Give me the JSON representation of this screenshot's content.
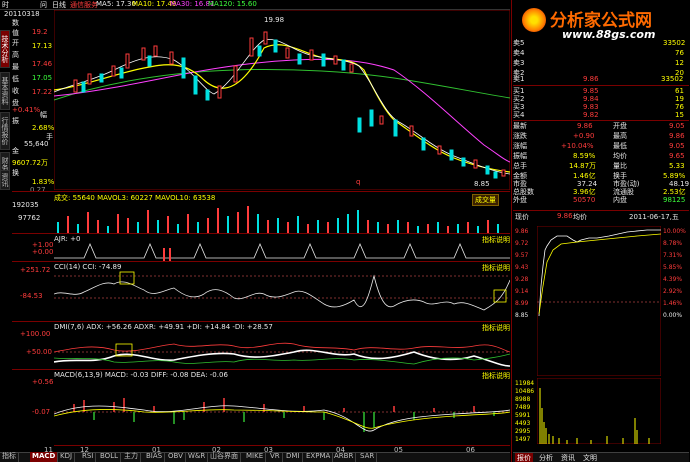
{
  "header": {
    "menu": [
      "时",
      "问",
      "日线",
      "通信服务"
    ],
    "date": "20110318",
    "ma5": "MA5: 17.30",
    "ma10": "MA10: 17.49",
    "ma30": "MA30: 16.81",
    "ma120": "MA120: 15.60",
    "high_mark": "19.98",
    "low_mark": "8.85",
    "mark_q": "q"
  },
  "logo": {
    "text": "分析家公式网",
    "url": "www.88gs.com"
  },
  "left_panel": {
    "items": [
      {
        "label": "数",
        "value": ""
      },
      {
        "label": "值",
        "value": "19.2"
      },
      {
        "label": "开",
        "value": "17.13"
      },
      {
        "label": "高",
        "value": ""
      },
      {
        "label": "最",
        "value": "17.46"
      },
      {
        "label": "低",
        "value": "17.05"
      },
      {
        "label": "收",
        "value": "17.22"
      },
      {
        "label": "盘",
        "value": ""
      },
      {
        "label": "幅",
        "value": "+0.41%"
      },
      {
        "label": "振",
        "value": "2.68%"
      },
      {
        "label": "手",
        "value": "55,640"
      },
      {
        "label": "金",
        "value": "9607.72万"
      },
      {
        "label": "换",
        "value": "1.83%"
      }
    ],
    "y_labels": [
      "0.00",
      "0.27"
    ]
  },
  "side_tabs": [
    "技术分析",
    "基本资料",
    "行情报价",
    "财务图示",
    "资讯"
  ],
  "volume_panel": {
    "title": "成交: 55640  MAVOL3: 60227  MAVOL10: 63538",
    "y_top": "192035",
    "y_mid": "97762",
    "button": "成交量"
  },
  "panel2": {
    "title": "AJR: +0",
    "y_top": "+1.00",
    "y_bot": "+0.00",
    "button": "指标说明"
  },
  "cci_panel": {
    "title": "CCI(14)  CCI: -74.89",
    "y_top": "+251.72",
    "y_bot": "-84.53",
    "button": "指标说明"
  },
  "dmi_panel": {
    "title": "DMI(7,6)  ADX: +56.26  ADXR: +49.91  +DI: +14.84  -DI: +28.57",
    "y_top": "+100.00",
    "y_mid": "+50.00",
    "button": "指标说明"
  },
  "macd_panel": {
    "title": "MACD(6,13,9)  MACD: -0.03  DIFF: -0.08  DEA: -0.06",
    "y_top": "+0.56",
    "y_mid": "-0.07",
    "button": "指标说明"
  },
  "x_axis": [
    "11",
    "12",
    "01",
    "02",
    "03",
    "04",
    "05",
    "06"
  ],
  "bottom_tabs": [
    "指标",
    "MACD",
    "KDJ",
    "RSI",
    "BOLL",
    "主力",
    "BIAS",
    "OBV",
    "W&R",
    "山谷界面",
    "MIKE",
    "VR",
    "DMI",
    "EXPMA",
    "ARBR",
    "SAR"
  ],
  "order_book": {
    "sell": [
      {
        "label": "卖5",
        "price": "",
        "vol": "33502"
      },
      {
        "label": "卖4",
        "price": "",
        "vol": "76"
      },
      {
        "label": "卖3",
        "price": "",
        "vol": "12"
      },
      {
        "label": "卖2",
        "price": "",
        "vol": "20"
      },
      {
        "label": "卖1",
        "price": "9.86",
        "vol": "33502"
      }
    ],
    "buy": [
      {
        "label": "买1",
        "price": "9.85",
        "vol": "61"
      },
      {
        "label": "买2",
        "price": "9.84",
        "vol": "19"
      },
      {
        "label": "买3",
        "price": "9.83",
        "vol": "76"
      },
      {
        "label": "买4",
        "price": "9.82",
        "vol": "15"
      },
      {
        "label": "买5",
        "price": "",
        "vol": ""
      }
    ]
  },
  "stats": [
    {
      "l1": "最新",
      "v1": "9.86",
      "l2": "开盘",
      "v2": "9.05"
    },
    {
      "l1": "涨跌",
      "v1": "+0.90",
      "l2": "最高",
      "v2": "9.86"
    },
    {
      "l1": "涨幅",
      "v1": "+10.04%",
      "l2": "最低",
      "v2": "9.05"
    },
    {
      "l1": "振幅",
      "v1": "8.59%",
      "l2": "均价",
      "v2": "9.65"
    },
    {
      "l1": "总手",
      "v1": "14.87万",
      "l2": "量比",
      "v2": "5.33"
    },
    {
      "l1": "金额",
      "v1": "1.46亿",
      "l2": "换手",
      "v2": "5.89%"
    },
    {
      "l1": "市盈",
      "v1": "37.24",
      "l2": "市盈(动)",
      "v2": "48.19"
    },
    {
      "l1": "总股数",
      "v1": "3.96亿",
      "l2": "流通股",
      "v2": "2.53亿"
    },
    {
      "l1": "外盘",
      "v1": "50570",
      "l2": "内盘",
      "v2": "98125"
    }
  ],
  "intraday": {
    "label_now": "现价",
    "price": "9.86",
    "avg_label": "均价",
    "date": "2011-06-17,五",
    "y_right": [
      "10.00%",
      "8.78%",
      "7.31%",
      "5.85%",
      "4.39%",
      "2.92%",
      "1.46%",
      "0.00%"
    ],
    "y_left": [
      "9.86",
      "9.72",
      "9.57",
      "9.43",
      "9.28",
      "9.14",
      "8.99",
      "8.85"
    ],
    "vol_labels": [
      "11984",
      "10486",
      "8988",
      "7489",
      "5991",
      "4493",
      "2995",
      "1497"
    ],
    "bottom": [
      "报价",
      "分析",
      "资讯",
      "文明"
    ]
  }
}
